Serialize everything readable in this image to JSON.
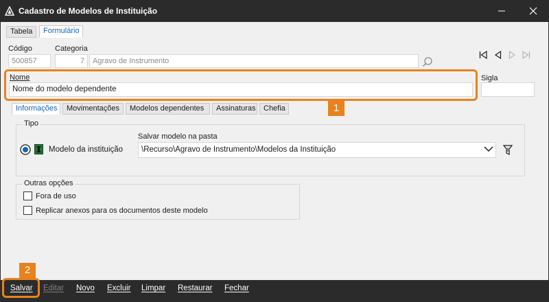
{
  "window": {
    "title": "Cadastro de Modelos de Instituição"
  },
  "tabs": [
    "Tabela",
    "Formulário"
  ],
  "form": {
    "codigo_label": "Código",
    "codigo_value": "500857",
    "categoria_label": "Categoria",
    "categoria_code": "7",
    "categoria_name": "Agravo de Instrumento",
    "nome_label": "Nome",
    "nome_value": "Nome do modelo dependente",
    "sigla_label": "Sigla",
    "sigla_value": ""
  },
  "subtabs": [
    "Informações",
    "Movimentações",
    "Modelos dependentes",
    "Assinaturas",
    "Chefia"
  ],
  "tipo": {
    "title": "Tipo",
    "radio_label": "Modelo da instituição",
    "folder_label": "Salvar modelo na pasta",
    "folder_value": "\\Recurso\\Agravo de Instrumento\\Modelos da Instituição"
  },
  "outras": {
    "title": "Outras opções",
    "opt1": "Fora de uso",
    "opt2": "Replicar anexos para os documentos deste modelo"
  },
  "annotations": {
    "badge1": "1",
    "badge2": "2"
  },
  "toolbar": {
    "salvar": "Salvar",
    "editar": "Editar",
    "novo": "Novo",
    "excluir": "Excluir",
    "limpar": "Limpar",
    "restaurar": "Restaurar",
    "fechar": "Fechar"
  },
  "colors": {
    "accent": "#e8821c",
    "active_tab": "#1466b8",
    "bar": "#2b2b2b"
  }
}
